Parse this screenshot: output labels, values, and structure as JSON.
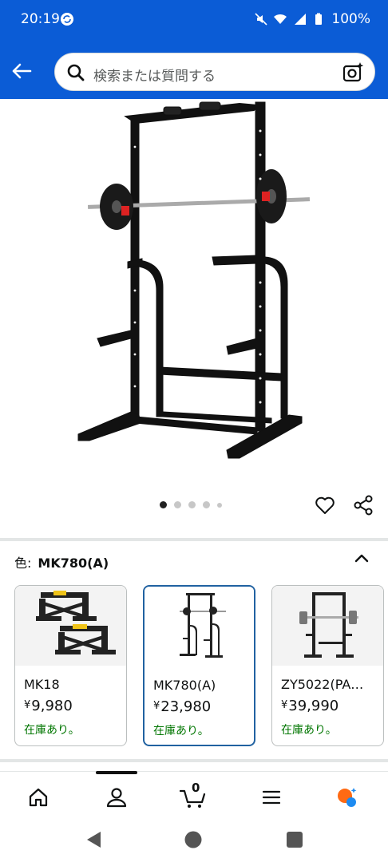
{
  "status_bar": {
    "time": "20:19",
    "battery": "100%"
  },
  "search": {
    "placeholder": "検索または質問する"
  },
  "carousel": {
    "total_images": 5,
    "active_index": 0
  },
  "variation": {
    "label": "色:",
    "selected": "MK780(A)"
  },
  "options": [
    {
      "name": "MK18",
      "currency": "¥",
      "price": "9,980",
      "stock": "在庫あり。"
    },
    {
      "name": "MK780(A)",
      "currency": "¥",
      "price": "23,980",
      "stock": "在庫あり。"
    },
    {
      "name": "ZY5022(PA…",
      "currency": "¥",
      "price": "39,990",
      "stock": "在庫あり。"
    }
  ],
  "bottom_nav": {
    "cart_count": "0"
  },
  "colors": {
    "brand_blue": "#0b5cd6",
    "selected_border": "#2162a1",
    "in_stock": "#007600",
    "rufus_orange": "#ff6a13"
  }
}
